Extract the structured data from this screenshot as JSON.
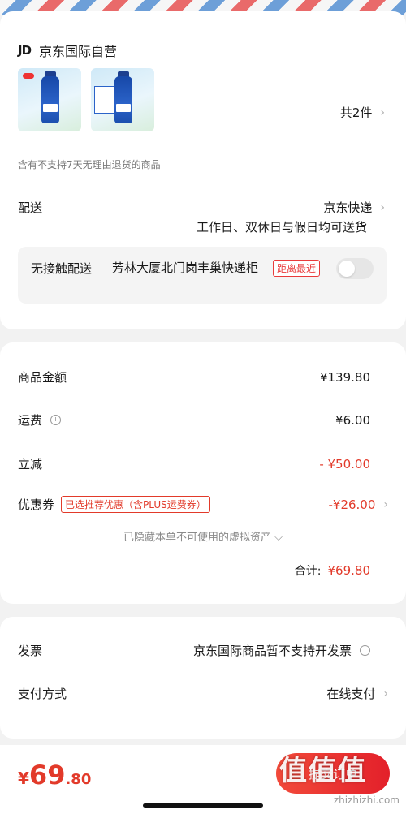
{
  "shop": {
    "logo": "JD",
    "name": "京东国际自营"
  },
  "products": {
    "count_label": "共2件",
    "chevron": "›"
  },
  "return_note": "含有不支持7天无理由退货的商品",
  "delivery": {
    "label": "配送",
    "method": "京东快递",
    "schedule": "工作日、双休日与假日均可送货",
    "contactless_label": "无接触配送",
    "contactless_address": "芳林大厦北门岗丰巢快递柜",
    "distance_badge": "距离最近",
    "contactless_enabled": false
  },
  "amounts": {
    "goods_label": "商品金额",
    "goods_value": "¥139.80",
    "shipping_label": "运费",
    "shipping_value": "¥6.00",
    "discount_label": "立减",
    "discount_value": "- ¥50.00",
    "coupon_label": "优惠券",
    "coupon_tag": "已选推荐优惠（含PLUS运费券）",
    "coupon_value": "-¥26.00",
    "hidden_note": "已隐藏本单不可使用的虚拟资产 ⌵",
    "total_label": "合计:",
    "total_value": "¥69.80"
  },
  "invoice": {
    "label": "发票",
    "value": "京东国际商品暂不支持开发票"
  },
  "payment": {
    "label": "支付方式",
    "value": "在线支付"
  },
  "bottom": {
    "currency": "¥",
    "price_int": "69",
    "price_dec": ".80",
    "submit_label": "提交订单"
  },
  "watermark": {
    "text": "值值值",
    "url": "zhizhizhi.com"
  },
  "colors": {
    "accent": "#e23a2a",
    "card": "#ffffff",
    "background": "#f2f2f2"
  }
}
